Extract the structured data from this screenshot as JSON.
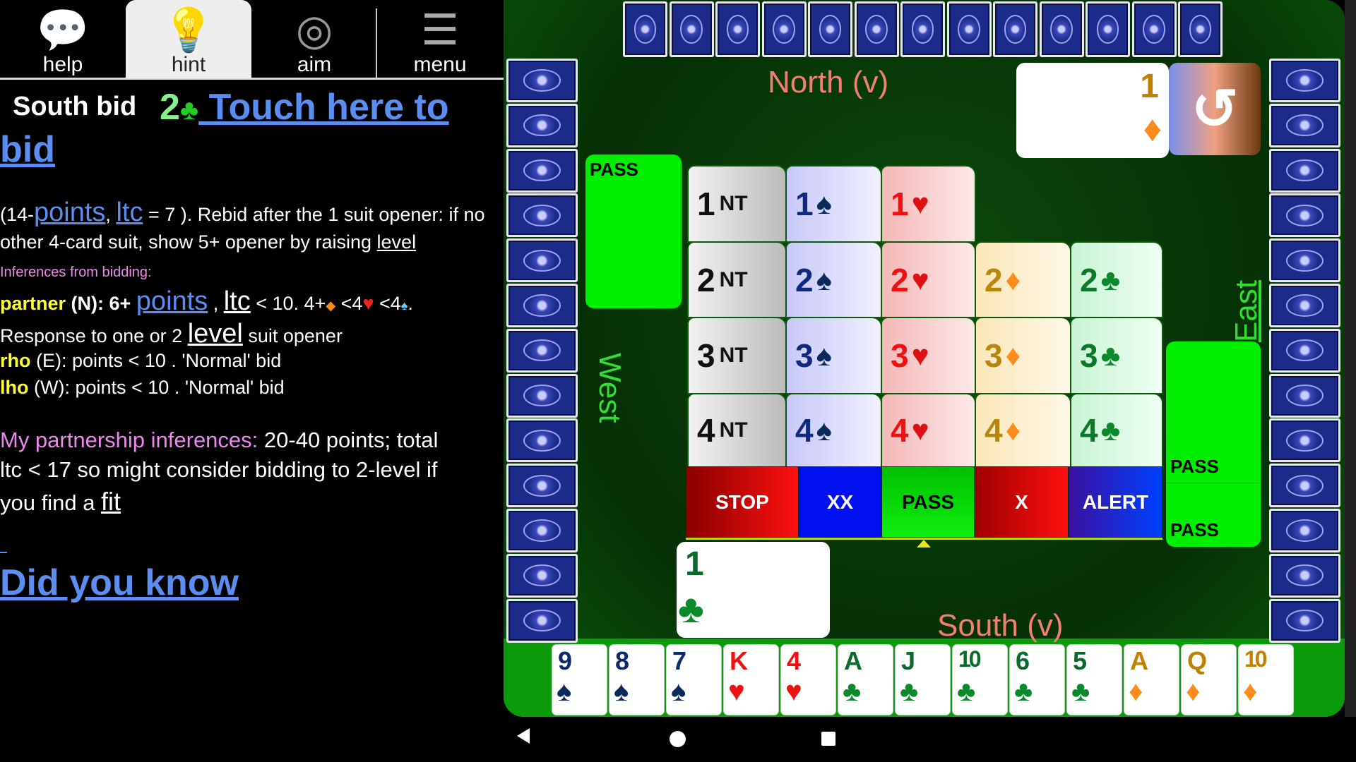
{
  "tabs": [
    {
      "label": "help",
      "icon": "help-bubble-icon",
      "active": false
    },
    {
      "label": "hint",
      "icon": "lightbulb-icon",
      "active": true
    },
    {
      "label": "aim",
      "icon": "dartboard-icon",
      "active": false
    },
    {
      "label": "menu",
      "icon": "menu-wrench-icon",
      "active": false
    }
  ],
  "hint": {
    "south_bid": "South bid",
    "bid_value": "2",
    "bid_suit": "♣",
    "touch_link_1": " Touch here to",
    "touch_link_2": "bid",
    "l1a": "(14-",
    "l1_points": "points",
    "l1b": ", ",
    "l1_ltc": "ltc",
    "l1c": " = 7 ).  Rebid after the 1 suit opener: if no",
    "l2a": "other 4-card suit, show 5+ opener by raising ",
    "l2_level": "level",
    "inferences_heading": "Inferences from bidding:",
    "partner_label": "partner",
    "partner_a": " (N): 6+ ",
    "partner_points": "points",
    "partner_b": " , ",
    "partner_ltc": "ltc",
    "partner_c": " < 10. 4+",
    "partner_d": " <4",
    "partner_e": " <4",
    "partner_f": ".",
    "response_a": "Response to one or 2 ",
    "response_level": "level",
    "response_b": " suit opener",
    "rho_label": "rho",
    "rho_text": " (E): points < 10 . 'Normal' bid",
    "lho_label": "lho",
    "lho_text": " (W): points < 10 . 'Normal' bid",
    "partnership_label": "My partnership inferences:",
    "partnership_a": "  20-40 points; total",
    "partnership_b": "ltc < 17 so might consider bidding to 2-level if",
    "partnership_c": "you find a ",
    "partnership_fit": "fit",
    "did_you_know": "Did you know"
  },
  "table": {
    "north_label": "North (v)",
    "south_label": "South (v)",
    "west_label": "West",
    "east_label": "East",
    "north_cards": 13,
    "west_cards": 13,
    "east_cards": 13,
    "north_bid": {
      "level": "1",
      "suit": "♦"
    },
    "south_bid": {
      "level": "1",
      "suit": "♣"
    },
    "west_bids": [
      "PASS"
    ],
    "east_bids": [
      "PASS",
      "PASS"
    ],
    "undo_icon": "undo-icon",
    "colors": {
      "felt": "#063006",
      "spade": "#0b2a6c",
      "heart": "#ee1111",
      "diamond": "#ff8c1a",
      "club": "#0a8a2a",
      "pass": "#00ee00"
    }
  },
  "bidding_box": {
    "rows": [
      {
        "level": "1",
        "bids": [
          "NT",
          "♠",
          "♥"
        ]
      },
      {
        "level": "2",
        "bids": [
          "NT",
          "♠",
          "♥",
          "♦",
          "♣"
        ]
      },
      {
        "level": "3",
        "bids": [
          "NT",
          "♠",
          "♥",
          "♦",
          "♣"
        ]
      },
      {
        "level": "4",
        "bids": [
          "NT",
          "♠",
          "♥",
          "♦",
          "♣"
        ]
      }
    ],
    "actions": [
      "STOP",
      "XX",
      "PASS",
      "X",
      "ALERT"
    ]
  },
  "hand": [
    {
      "rank": "9",
      "suit": "♠"
    },
    {
      "rank": "8",
      "suit": "♠"
    },
    {
      "rank": "7",
      "suit": "♠"
    },
    {
      "rank": "K",
      "suit": "♥"
    },
    {
      "rank": "4",
      "suit": "♥"
    },
    {
      "rank": "A",
      "suit": "♣"
    },
    {
      "rank": "J",
      "suit": "♣"
    },
    {
      "rank": "10",
      "suit": "♣"
    },
    {
      "rank": "6",
      "suit": "♣"
    },
    {
      "rank": "5",
      "suit": "♣"
    },
    {
      "rank": "A",
      "suit": "♦"
    },
    {
      "rank": "Q",
      "suit": "♦"
    },
    {
      "rank": "10",
      "suit": "♦"
    }
  ],
  "nav": {
    "back": "back-icon",
    "home": "home-icon",
    "recents": "recents-icon"
  }
}
